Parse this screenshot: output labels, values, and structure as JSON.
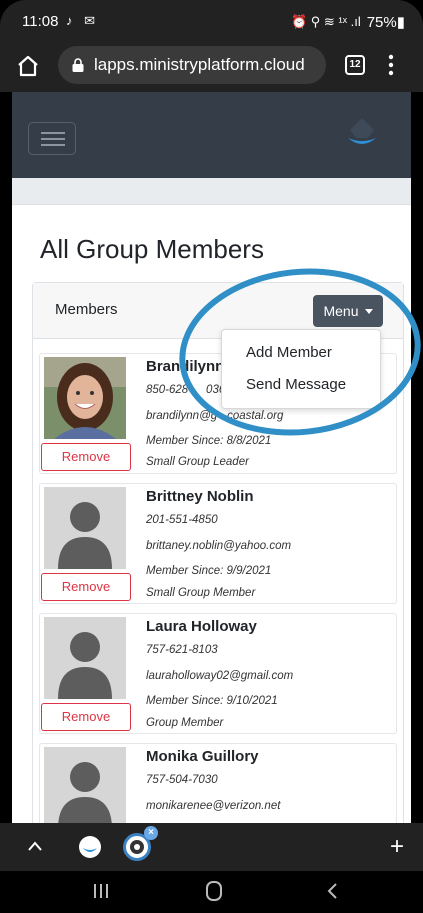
{
  "status_bar": {
    "time": "11:08",
    "left_icons": "♪ ✉",
    "right_icons": "⏰ ⚲ ≋ ¹ˣ .ıl",
    "battery": "75%▮"
  },
  "browser": {
    "url": "lapps.ministryplatform.cloud",
    "tab_count": "12"
  },
  "page": {
    "title": "All Group Members"
  },
  "card": {
    "title": "Members",
    "menu_label": "Menu"
  },
  "dropdown": {
    "items": [
      "Add Member",
      "Send Message"
    ]
  },
  "members": [
    {
      "name": "Brandilynn",
      "phone": "850-628-",
      "phone_tail": "036",
      "email": "brandilynn@g",
      "email_tail": "coastal.org",
      "since": "Member Since: 8/8/2021",
      "role": "Small Group Leader",
      "remove": "Remove"
    },
    {
      "name": "Brittney Noblin",
      "phone": "201-551-4850",
      "email": "brittaney.noblin@yahoo.com",
      "since": "Member Since: 9/9/2021",
      "role": "Small Group Member",
      "remove": "Remove"
    },
    {
      "name": "Laura Holloway",
      "phone": "757-621-8103",
      "email": "lauraholloway02@gmail.com",
      "since": "Member Since: 9/10/2021",
      "role": "Group Member",
      "remove": "Remove"
    },
    {
      "name": "Monika Guillory",
      "phone": "757-504-7030",
      "email": "monikarenee@verizon.net"
    }
  ],
  "colors": {
    "nav_bg": "#343d48",
    "menu_button": "#495460",
    "remove_red": "#dc3545",
    "annotation_blue": "#2f8fc6"
  }
}
